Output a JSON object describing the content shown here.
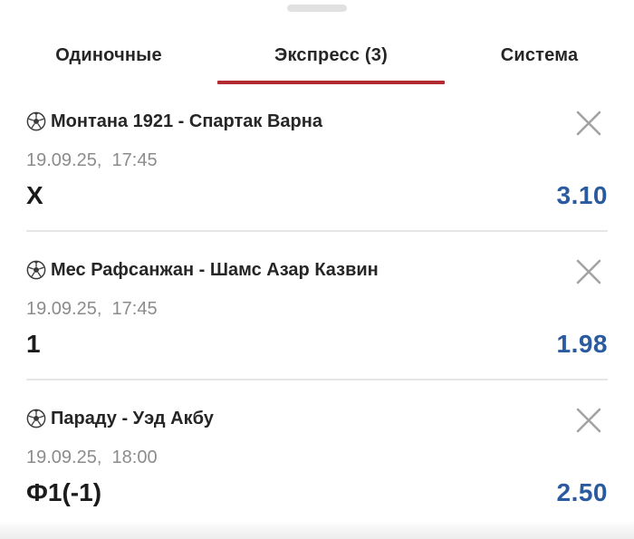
{
  "tabs": [
    {
      "label": "Одиночные",
      "active": false
    },
    {
      "label": "Экспресс (3)",
      "active": true
    },
    {
      "label": "Система",
      "active": false
    }
  ],
  "accent_color": "#b12b31",
  "odds_color": "#2a5aa0",
  "bets": [
    {
      "match": "Монтана 1921 - Спартак Варна",
      "datetime": "19.09.25,  17:45",
      "outcome": "X",
      "odds": "3.10",
      "sport_icon": "soccer-ball-icon",
      "remove_icon": "close-icon"
    },
    {
      "match": "Мес Рафсанжан - Шамс Азар Казвин",
      "datetime": "19.09.25,  17:45",
      "outcome": "1",
      "odds": "1.98",
      "sport_icon": "soccer-ball-icon",
      "remove_icon": "close-icon"
    },
    {
      "match": "Параду - Уэд Акбу",
      "datetime": "19.09.25,  18:00",
      "outcome": "Ф1(-1)",
      "odds": "2.50",
      "sport_icon": "soccer-ball-icon",
      "remove_icon": "close-icon"
    }
  ]
}
